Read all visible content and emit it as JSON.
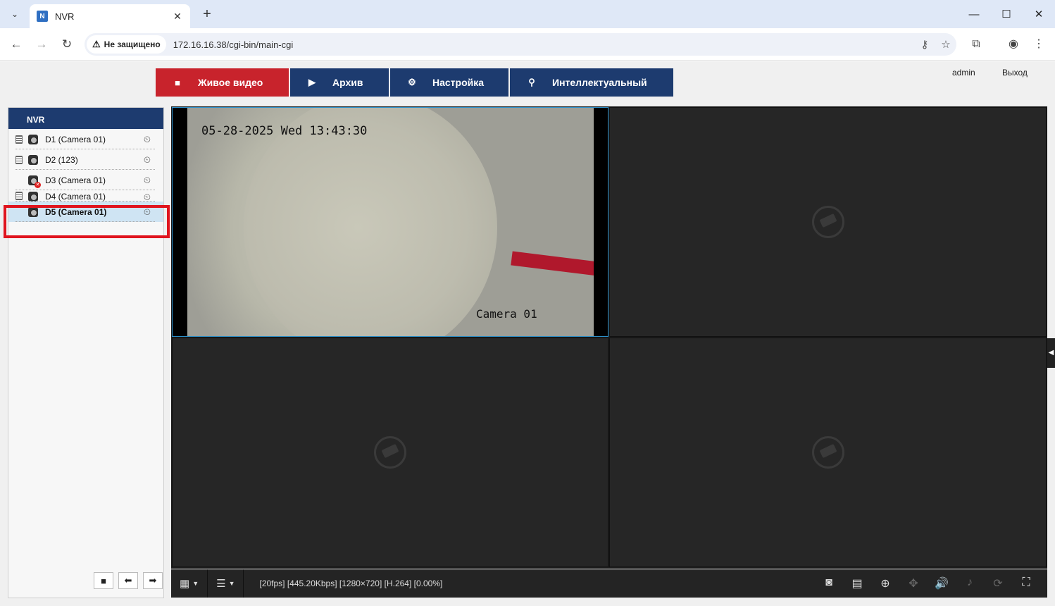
{
  "browser": {
    "tab_title": "NVR",
    "tab_favicon_text": "N",
    "security_label": "Не защищено",
    "url": "172.16.16.38/cgi-bin/main-cgi"
  },
  "nav": {
    "items": [
      {
        "label": "Живое видео",
        "icon": "video-icon",
        "active": true
      },
      {
        "label": "Архив",
        "icon": "playback-icon",
        "active": false
      },
      {
        "label": "Настройка",
        "icon": "gear-icon",
        "active": false
      },
      {
        "label": "Интеллектуальный",
        "icon": "search-icon",
        "active": false
      }
    ],
    "user": "admin",
    "logout": "Выход"
  },
  "sidebar": {
    "title": "NVR",
    "cameras": [
      {
        "label": "D1 (Camera 01)",
        "recording": true,
        "error": false,
        "selected": false
      },
      {
        "label": "D2 (123)",
        "recording": true,
        "error": false,
        "selected": false
      },
      {
        "label": "D3 (Camera 01)",
        "recording": false,
        "error": true,
        "selected": false
      },
      {
        "label": "D4 (Camera 01)",
        "recording": true,
        "error": false,
        "selected": false
      },
      {
        "label": "D5 (Camera 01)",
        "recording": false,
        "error": false,
        "selected": true
      }
    ]
  },
  "video": {
    "osd_time": "05-28-2025 Wed 13:43:30",
    "osd_camera": "Camera 01",
    "status": "[20fps] [445.20Kbps] [1280×720] [H.264] [0.00%]"
  },
  "colors": {
    "nav_active": "#c8232c",
    "nav_default": "#1d3b6f",
    "highlight": "#e0141e"
  }
}
